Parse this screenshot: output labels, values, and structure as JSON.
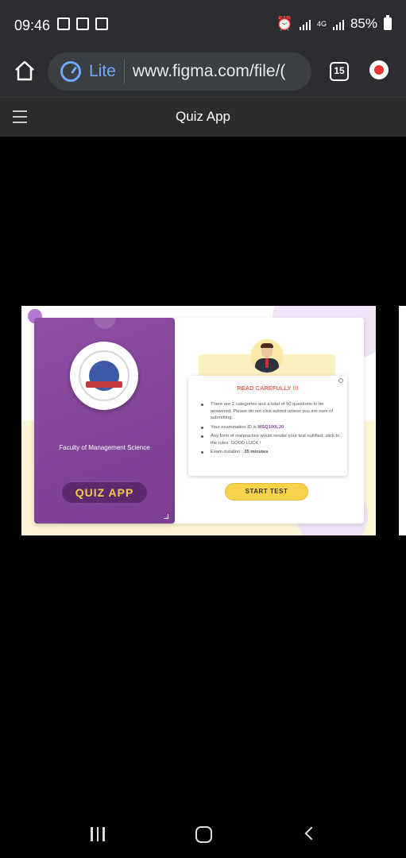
{
  "status": {
    "time": "09:46",
    "network": "4G",
    "battery": "85%"
  },
  "browser": {
    "lite_label": "Lite",
    "url": "www.figma.com/file/(",
    "tab_count": "15"
  },
  "app": {
    "title": "Quiz App"
  },
  "frame": {
    "left": {
      "faculty": "Faculty of Management Science",
      "badge": "QUIZ APP"
    },
    "notice": {
      "heading": "READ CAREFULLY !!!",
      "item1": "There are 2 categories and a total of 50 questions to be answered. Please do not click submit unless you are sure of submitting.",
      "item2_prefix": "Your examination ID is ",
      "item2_id": "MSQ100L20",
      "item3": "Any form of malpractice would render your test nullified, stick to the rules. GOOD LUCK !",
      "item4_prefix": "Exam duration : ",
      "item4_value": "35 minutes"
    },
    "start_label": "START TEST"
  }
}
